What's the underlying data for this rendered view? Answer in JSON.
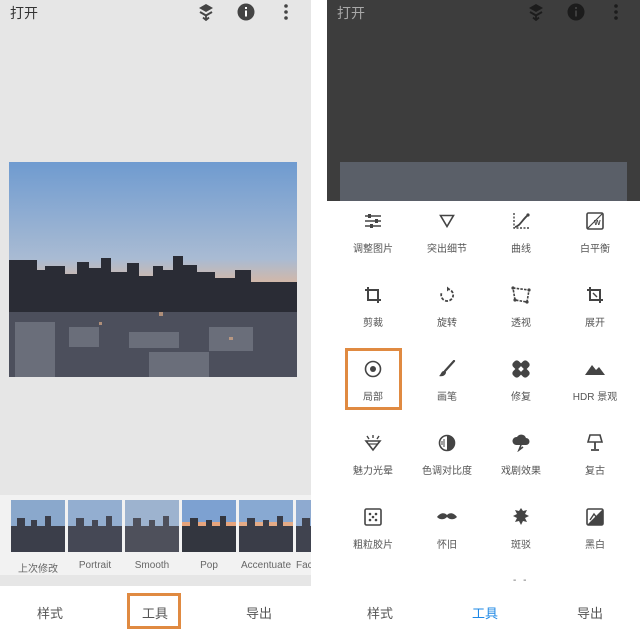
{
  "left": {
    "app_title": "打开",
    "filters": [
      {
        "label": "上次修改"
      },
      {
        "label": "Portrait"
      },
      {
        "label": "Smooth"
      },
      {
        "label": "Pop"
      },
      {
        "label": "Accentuate"
      },
      {
        "label": "Fac"
      }
    ],
    "tabs": {
      "styles": "样式",
      "tools": "工具",
      "export": "导出"
    },
    "active_tab": "tools"
  },
  "right": {
    "app_title": "打开",
    "tools": [
      {
        "label": "调整图片",
        "icon": "sliders-icon"
      },
      {
        "label": "突出细节",
        "icon": "triangle-down-icon"
      },
      {
        "label": "曲线",
        "icon": "curves-icon"
      },
      {
        "label": "白平衡",
        "icon": "white-balance-icon"
      },
      {
        "label": "剪裁",
        "icon": "crop-icon"
      },
      {
        "label": "旋转",
        "icon": "rotate-icon"
      },
      {
        "label": "透视",
        "icon": "perspective-icon"
      },
      {
        "label": "展开",
        "icon": "expand-icon"
      },
      {
        "label": "局部",
        "icon": "selective-icon"
      },
      {
        "label": "画笔",
        "icon": "brush-icon"
      },
      {
        "label": "修复",
        "icon": "healing-icon"
      },
      {
        "label": "HDR 景观",
        "icon": "mountain-icon"
      },
      {
        "label": "魅力光晕",
        "icon": "glamour-glow-icon"
      },
      {
        "label": "色调对比度",
        "icon": "tonal-contrast-icon"
      },
      {
        "label": "戏剧效果",
        "icon": "drama-cloud-icon"
      },
      {
        "label": "复古",
        "icon": "lamp-icon"
      },
      {
        "label": "粗粒胶片",
        "icon": "grainy-film-icon"
      },
      {
        "label": "怀旧",
        "icon": "mustache-icon"
      },
      {
        "label": "斑驳",
        "icon": "grunge-icon"
      },
      {
        "label": "黑白",
        "icon": "black-white-icon"
      }
    ],
    "tabs": {
      "styles": "样式",
      "tools": "工具",
      "export": "导出"
    },
    "active_tab": "tools"
  },
  "colors": {
    "accent": "#1e88e5",
    "highlight": "#e08a41",
    "icon": "#444444"
  }
}
